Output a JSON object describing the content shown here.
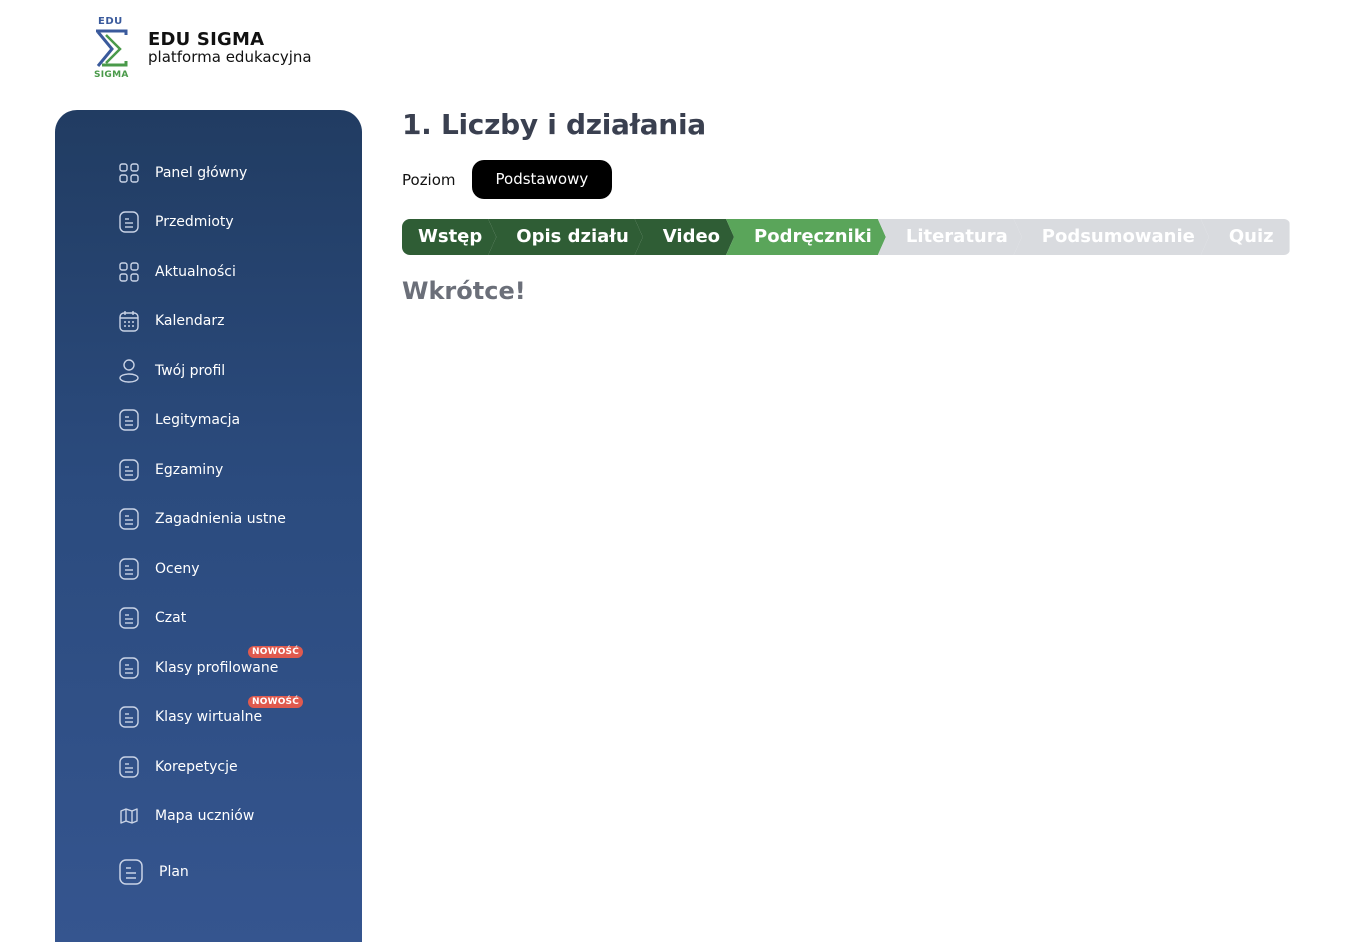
{
  "brand": {
    "mark_top": "EDU",
    "mark_bottom": "SIGMA",
    "title": "EDU SIGMA",
    "subtitle": "platforma edukacyjna"
  },
  "sidebar": {
    "items": [
      {
        "label": "Panel główny",
        "icon": "grid-icon"
      },
      {
        "label": "Przedmioty",
        "icon": "document-icon"
      },
      {
        "label": "Aktualności",
        "icon": "grid-icon"
      },
      {
        "label": "Kalendarz",
        "icon": "calendar-icon"
      },
      {
        "label": "Twój profil",
        "icon": "user-icon"
      },
      {
        "label": "Legitymacja",
        "icon": "document-icon"
      },
      {
        "label": "Egzaminy",
        "icon": "document-icon"
      },
      {
        "label": "Zagadnienia ustne",
        "icon": "document-icon"
      },
      {
        "label": "Oceny",
        "icon": "document-icon"
      },
      {
        "label": "Czat",
        "icon": "document-icon"
      },
      {
        "label": "Klasy profilowane",
        "icon": "document-icon",
        "badge": "NOWOŚĆ"
      },
      {
        "label": "Klasy wirtualne",
        "icon": "document-icon",
        "badge": "NOWOŚĆ"
      },
      {
        "label": "Korepetycje",
        "icon": "document-icon"
      },
      {
        "label": "Mapa uczniów",
        "icon": "map-icon"
      },
      {
        "label": "Plan",
        "icon": "document-icon"
      }
    ]
  },
  "main": {
    "title": "1. Liczby i działania",
    "level_label": "Poziom",
    "level_value": "Podstawowy",
    "steps": [
      {
        "label": "Wstęp",
        "state": "done"
      },
      {
        "label": "Opis działu",
        "state": "done"
      },
      {
        "label": "Video",
        "state": "done"
      },
      {
        "label": "Podręczniki",
        "state": "active"
      },
      {
        "label": "Literatura",
        "state": "todo"
      },
      {
        "label": "Podsumowanie",
        "state": "todo"
      },
      {
        "label": "Quiz",
        "state": "todo"
      }
    ],
    "message": "Wkrótce!"
  },
  "colors": {
    "sidebar_top": "#213c62",
    "sidebar_bottom": "#35558f",
    "step_done": "#2f5d35",
    "step_active": "#5aa55a",
    "step_todo": "#d9dbdf",
    "badge": "#e05a4e"
  }
}
